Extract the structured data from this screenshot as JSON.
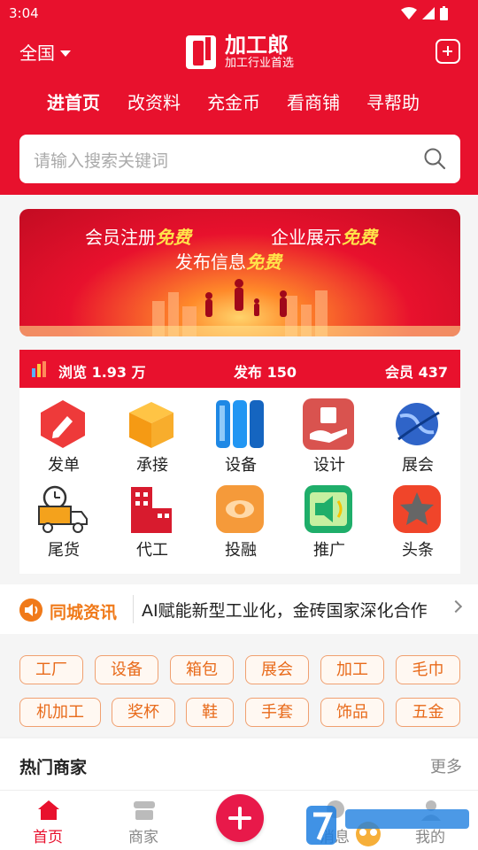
{
  "status_bar": {
    "time": "3:04"
  },
  "header": {
    "region": "全国",
    "app_name": "加工郎",
    "slogan": "加工行业首选",
    "tabs": [
      "进首页",
      "改资料",
      "充金币",
      "看商铺",
      "寻帮助"
    ]
  },
  "search": {
    "placeholder": "请输入搜索关键词"
  },
  "banner": {
    "line1_a": "会员注册",
    "line1_b": "免费",
    "line2_a": "企业展示",
    "line2_b": "免费",
    "line3_a": "发布信息",
    "line3_b": "免费"
  },
  "stats": {
    "views": "浏览 1.93 万",
    "posts": "发布 150",
    "members": "会员 437"
  },
  "grid": [
    {
      "label": "发单",
      "icon": "edit-icon",
      "color": "#ee3a3a"
    },
    {
      "label": "承接",
      "icon": "box-icon",
      "color": "#f59a14"
    },
    {
      "label": "设备",
      "icon": "device-icon",
      "color": "#1e88e5"
    },
    {
      "label": "设计",
      "icon": "design-icon",
      "color": "#d9534f"
    },
    {
      "label": "展会",
      "icon": "globe-icon",
      "color": "#2f64c8"
    },
    {
      "label": "尾货",
      "icon": "truck-icon",
      "color": "#f4a21c"
    },
    {
      "label": "代工",
      "icon": "building-icon",
      "color": "#d81b2e"
    },
    {
      "label": "投融",
      "icon": "eye-icon",
      "color": "#f59a3a"
    },
    {
      "label": "推广",
      "icon": "megaphone-icon",
      "color": "#1fae6a"
    },
    {
      "label": "头条",
      "icon": "star-icon",
      "color": "#f0452a"
    }
  ],
  "news": {
    "tag": "同城资讯",
    "text": "AI赋能新型工业化，金砖国家深化合作"
  },
  "tags": [
    "工厂",
    "设备",
    "箱包",
    "展会",
    "加工",
    "毛巾",
    "机加工",
    "奖杯",
    "鞋",
    "手套",
    "饰品",
    "五金"
  ],
  "hot": {
    "title": "热门商家",
    "more": "更多"
  },
  "tabbar": {
    "home": "首页",
    "merchant": "商家",
    "messages": "消息",
    "mine": "我的"
  },
  "colors": {
    "brand_red": "#e8112d",
    "accent_orange": "#f07a1a"
  }
}
